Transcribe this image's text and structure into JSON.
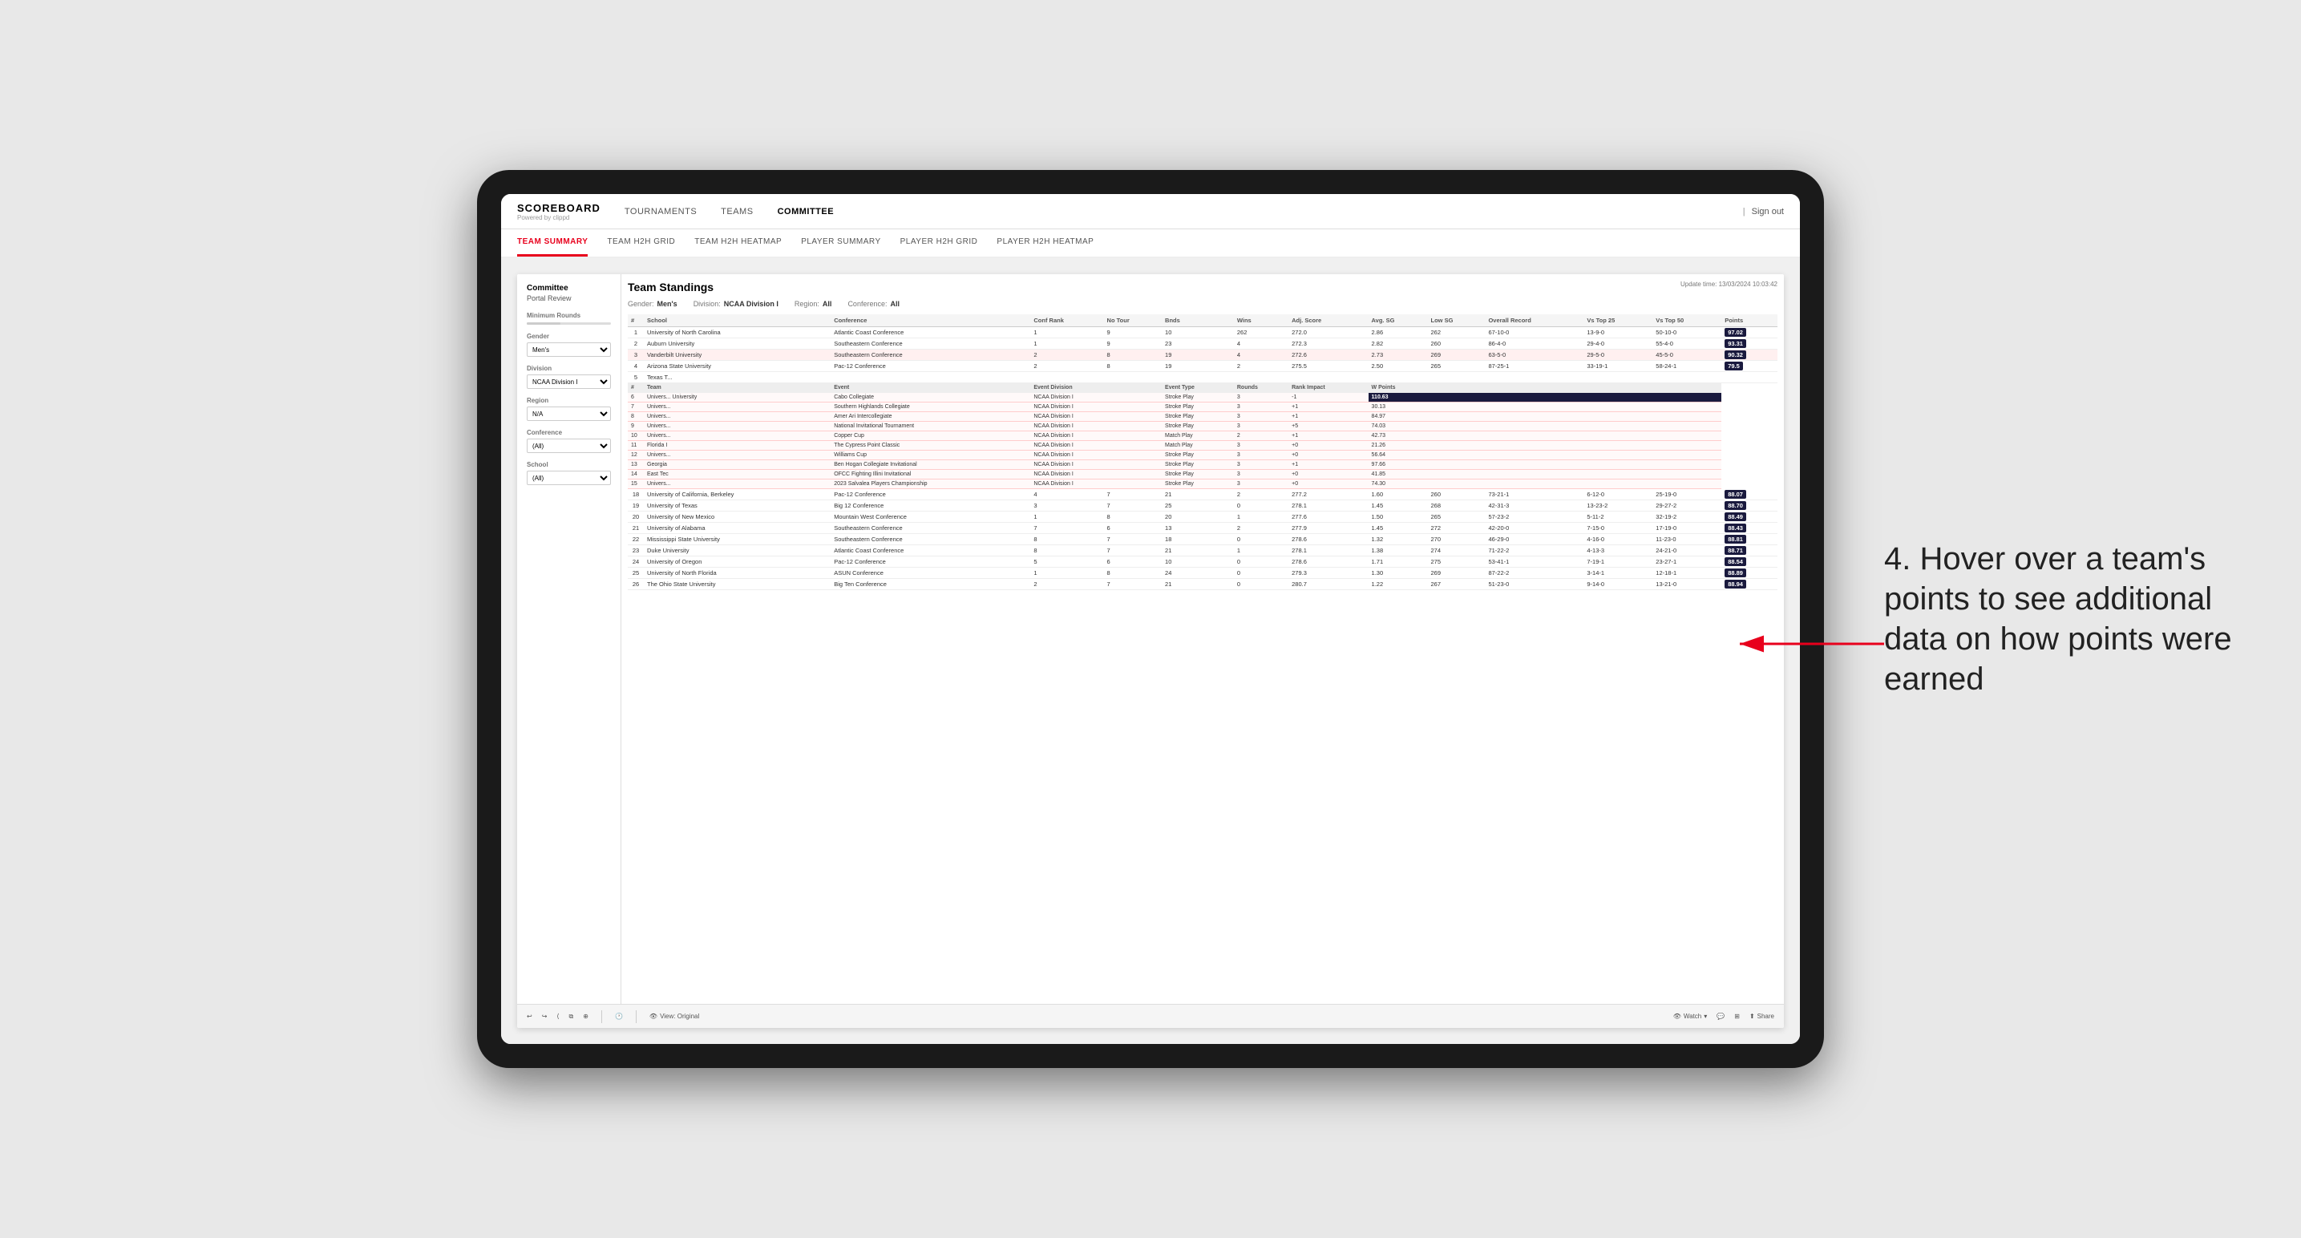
{
  "app": {
    "logo_title": "SCOREBOARD",
    "logo_sub": "Powered by clippd",
    "sign_out": "Sign out"
  },
  "top_nav": {
    "items": [
      {
        "label": "TOURNAMENTS",
        "active": false
      },
      {
        "label": "TEAMS",
        "active": false
      },
      {
        "label": "COMMITTEE",
        "active": true
      }
    ]
  },
  "secondary_nav": {
    "items": [
      {
        "label": "TEAM SUMMARY",
        "active": true
      },
      {
        "label": "TEAM H2H GRID",
        "active": false
      },
      {
        "label": "TEAM H2H HEATMAP",
        "active": false
      },
      {
        "label": "PLAYER SUMMARY",
        "active": false
      },
      {
        "label": "PLAYER H2H GRID",
        "active": false
      },
      {
        "label": "PLAYER H2H HEATMAP",
        "active": false
      }
    ]
  },
  "sidebar": {
    "title": "Committee",
    "subtitle": "Portal Review",
    "filters": [
      {
        "label": "Minimum Rounds",
        "type": "range"
      },
      {
        "label": "Gender",
        "type": "select",
        "value": "Men's"
      },
      {
        "label": "Division",
        "type": "select",
        "value": "NCAA Division I"
      },
      {
        "label": "Region",
        "type": "select",
        "value": "N/A"
      },
      {
        "label": "Conference",
        "type": "select",
        "value": "(All)"
      },
      {
        "label": "School",
        "type": "select",
        "value": "(All)"
      }
    ]
  },
  "report": {
    "title": "Team Standings",
    "update_time": "Update time: 13/03/2024 10:03:42",
    "filters": {
      "gender_label": "Gender:",
      "gender_value": "Men's",
      "division_label": "Division:",
      "division_value": "NCAA Division I",
      "region_label": "Region:",
      "region_value": "All",
      "conference_label": "Conference:",
      "conference_value": "All"
    },
    "columns": [
      "#",
      "School",
      "Conference",
      "Conf Rank",
      "No Tour",
      "Bnds",
      "Wins",
      "Adj. Score",
      "Avg. SG",
      "Low SG",
      "Overall Record",
      "Vs Top 25",
      "Vs Top 50",
      "Points"
    ],
    "rows": [
      {
        "rank": "1",
        "school": "University of North Carolina",
        "conference": "Atlantic Coast Conference",
        "conf_rank": "1",
        "tours": "9",
        "bnds": "10",
        "wins": "262",
        "adj_score": "272.0",
        "avg_sg": "2.86",
        "low_sg": "262",
        "overall": "67-10-0",
        "vs25": "13-9-0",
        "vs50": "50-10-0",
        "points": "97.02",
        "highlight": false
      },
      {
        "rank": "2",
        "school": "Auburn University",
        "conference": "Southeastern Conference",
        "conf_rank": "1",
        "tours": "9",
        "bnds": "23",
        "wins": "4",
        "adj_score": "272.3",
        "avg_sg": "2.82",
        "low_sg": "260",
        "overall": "86-4-0",
        "vs25": "29-4-0",
        "vs50": "55-4-0",
        "points": "93.31",
        "highlight": false
      },
      {
        "rank": "3",
        "school": "Vanderbilt University",
        "conference": "Southeastern Conference",
        "conf_rank": "2",
        "tours": "8",
        "bnds": "19",
        "wins": "4",
        "adj_score": "272.6",
        "avg_sg": "2.73",
        "low_sg": "269",
        "overall": "63-5-0",
        "vs25": "29-5-0",
        "vs50": "45-5-0",
        "points": "90.32",
        "highlight": true
      },
      {
        "rank": "4",
        "school": "Arizona State University",
        "conference": "Pac-12 Conference",
        "conf_rank": "2",
        "tours": "8",
        "bnds": "19",
        "wins": "2",
        "adj_score": "275.5",
        "avg_sg": "2.50",
        "low_sg": "265",
        "overall": "87-25-1",
        "vs25": "33-19-1",
        "vs50": "58-24-1",
        "points": "79.5",
        "highlight": false
      },
      {
        "rank": "5",
        "school": "Texas T...",
        "conference": "...",
        "conf_rank": "",
        "tours": "",
        "bnds": "",
        "wins": "",
        "adj_score": "",
        "avg_sg": "",
        "low_sg": "",
        "overall": "",
        "vs25": "",
        "vs50": "",
        "points": "",
        "highlight": false
      }
    ],
    "hover_rows": [
      {
        "rank": "6",
        "team": "Univers...",
        "event": "Cabo Collegiate",
        "event_div": "NCAA Division I",
        "event_type": "Stroke Play",
        "rounds": "3",
        "rank_impact": "-1",
        "w_points": "110.63"
      },
      {
        "rank": "7",
        "team": "Univers...",
        "event": "Southern Highlands Collegiate",
        "event_div": "NCAA Division I",
        "event_type": "Stroke Play",
        "rounds": "3",
        "rank_impact": "+1",
        "w_points": "30.13"
      },
      {
        "rank": "8",
        "team": "Univers...",
        "event": "Amer Ari Intercollegiate",
        "event_div": "NCAA Division I",
        "event_type": "Stroke Play",
        "rounds": "3",
        "rank_impact": "+1",
        "w_points": "84.97"
      },
      {
        "rank": "9",
        "team": "Univers...",
        "event": "National Invitational Tournament",
        "event_div": "NCAA Division I",
        "event_type": "Stroke Play",
        "rounds": "3",
        "rank_impact": "+5",
        "w_points": "74.03"
      },
      {
        "rank": "10",
        "team": "Univers...",
        "event": "Copper Cup",
        "event_div": "NCAA Division I",
        "event_type": "Match Play",
        "rounds": "2",
        "rank_impact": "+1",
        "w_points": "42.73"
      },
      {
        "rank": "11",
        "team": "Florida I",
        "event": "The Cypress Point Classic",
        "event_div": "NCAA Division I",
        "event_type": "Match Play",
        "rounds": "3",
        "rank_impact": "+0",
        "w_points": "21.26"
      },
      {
        "rank": "12",
        "team": "Univers...",
        "event": "Williams Cup",
        "event_div": "NCAA Division I",
        "event_type": "Stroke Play",
        "rounds": "3",
        "rank_impact": "+0",
        "w_points": "56.64"
      },
      {
        "rank": "13",
        "team": "Georgia",
        "event": "Ben Hogan Collegiate Invitational",
        "event_div": "NCAA Division I",
        "event_type": "Stroke Play",
        "rounds": "3",
        "rank_impact": "+1",
        "w_points": "97.66"
      },
      {
        "rank": "14",
        "team": "East Tec",
        "event": "OFCC Fighting Illini Invitational",
        "event_div": "NCAA Division I",
        "event_type": "Stroke Play",
        "rounds": "3",
        "rank_impact": "+0",
        "w_points": "41.85"
      },
      {
        "rank": "15",
        "team": "Univers...",
        "event": "2023 Salvalea Players Championship",
        "event_div": "NCAA Division I",
        "event_type": "Stroke Play",
        "rounds": "3",
        "rank_impact": "+0",
        "w_points": "74.30"
      }
    ],
    "more_rows": [
      {
        "rank": "18",
        "school": "University of California, Berkeley",
        "conference": "Pac-12 Conference",
        "conf_rank": "4",
        "tours": "7",
        "bnds": "21",
        "wins": "2",
        "adj_score": "277.2",
        "avg_sg": "1.60",
        "low_sg": "260",
        "overall": "73-21-1",
        "vs25": "6-12-0",
        "vs50": "25-19-0",
        "points": "88.07"
      },
      {
        "rank": "19",
        "school": "University of Texas",
        "conference": "Big 12 Conference",
        "conf_rank": "3",
        "tours": "7",
        "bnds": "25",
        "wins": "0",
        "adj_score": "278.1",
        "avg_sg": "1.45",
        "low_sg": "268",
        "overall": "42-31-3",
        "vs25": "13-23-2",
        "vs50": "29-27-2",
        "points": "88.70"
      },
      {
        "rank": "20",
        "school": "University of New Mexico",
        "conference": "Mountain West Conference",
        "conf_rank": "1",
        "tours": "8",
        "bnds": "20",
        "wins": "1",
        "adj_score": "277.6",
        "avg_sg": "1.50",
        "low_sg": "265",
        "overall": "57-23-2",
        "vs25": "5-11-2",
        "vs50": "32-19-2",
        "points": "88.49"
      },
      {
        "rank": "21",
        "school": "University of Alabama",
        "conference": "Southeastern Conference",
        "conf_rank": "7",
        "tours": "6",
        "bnds": "13",
        "wins": "2",
        "adj_score": "277.9",
        "avg_sg": "1.45",
        "low_sg": "272",
        "overall": "42-20-0",
        "vs25": "7-15-0",
        "vs50": "17-19-0",
        "points": "88.43"
      },
      {
        "rank": "22",
        "school": "Mississippi State University",
        "conference": "Southeastern Conference",
        "conf_rank": "8",
        "tours": "7",
        "bnds": "18",
        "wins": "0",
        "adj_score": "278.6",
        "avg_sg": "1.32",
        "low_sg": "270",
        "overall": "46-29-0",
        "vs25": "4-16-0",
        "vs50": "11-23-0",
        "points": "88.81"
      },
      {
        "rank": "23",
        "school": "Duke University",
        "conference": "Atlantic Coast Conference",
        "conf_rank": "8",
        "tours": "7",
        "bnds": "21",
        "wins": "1",
        "adj_score": "278.1",
        "avg_sg": "1.38",
        "low_sg": "274",
        "overall": "71-22-2",
        "vs25": "4-13-3",
        "vs50": "24-21-0",
        "points": "88.71"
      },
      {
        "rank": "24",
        "school": "University of Oregon",
        "conference": "Pac-12 Conference",
        "conf_rank": "5",
        "tours": "6",
        "bnds": "10",
        "wins": "0",
        "adj_score": "278.6",
        "avg_sg": "1.71",
        "low_sg": "275",
        "overall": "53-41-1",
        "vs25": "7-19-1",
        "vs50": "23-27-1",
        "points": "88.54"
      },
      {
        "rank": "25",
        "school": "University of North Florida",
        "conference": "ASUN Conference",
        "conf_rank": "1",
        "tours": "8",
        "bnds": "24",
        "wins": "0",
        "adj_score": "279.3",
        "avg_sg": "1.30",
        "low_sg": "269",
        "overall": "87-22-2",
        "vs25": "3-14-1",
        "vs50": "12-18-1",
        "points": "88.89"
      },
      {
        "rank": "26",
        "school": "The Ohio State University",
        "conference": "Big Ten Conference",
        "conf_rank": "2",
        "tours": "7",
        "bnds": "21",
        "wins": "0",
        "adj_score": "280.7",
        "avg_sg": "1.22",
        "low_sg": "267",
        "overall": "51-23-0",
        "vs25": "9-14-0",
        "vs50": "13-21-0",
        "points": "88.94"
      }
    ]
  },
  "toolbar": {
    "view_label": "View: Original",
    "watch_label": "Watch",
    "share_label": "Share"
  },
  "annotation": {
    "text": "4. Hover over a team's points to see additional data on how points were earned"
  }
}
